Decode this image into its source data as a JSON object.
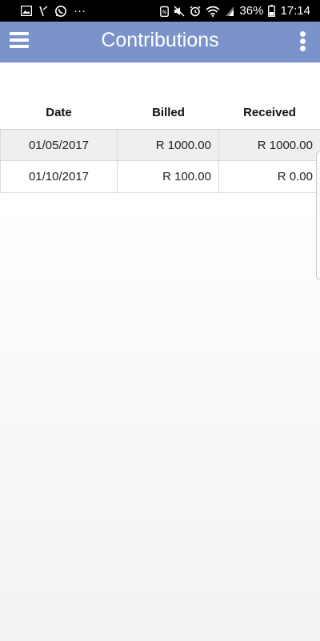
{
  "status_bar": {
    "icons_left": [
      "gallery-icon",
      "missed-call-icon",
      "whatsapp-icon"
    ],
    "more_notifications": "···",
    "icons_right": [
      "nfc-icon",
      "mute-icon",
      "alarm-icon",
      "wifi-icon",
      "signal-icon"
    ],
    "battery": "36%",
    "time": "17:14"
  },
  "app_bar": {
    "title": "Contributions",
    "menu_icon": "hamburger-menu-icon",
    "overflow_icon": "more-vertical-icon",
    "color": "#7b93ca"
  },
  "table": {
    "headers": {
      "date": "Date",
      "billed": "Billed",
      "received": "Received"
    },
    "rows": [
      {
        "date": "01/05/2017",
        "billed": "R 1000.00",
        "received": "R 1000.00"
      },
      {
        "date": "01/10/2017",
        "billed": "R 100.00",
        "received": "R 0.00"
      }
    ]
  }
}
